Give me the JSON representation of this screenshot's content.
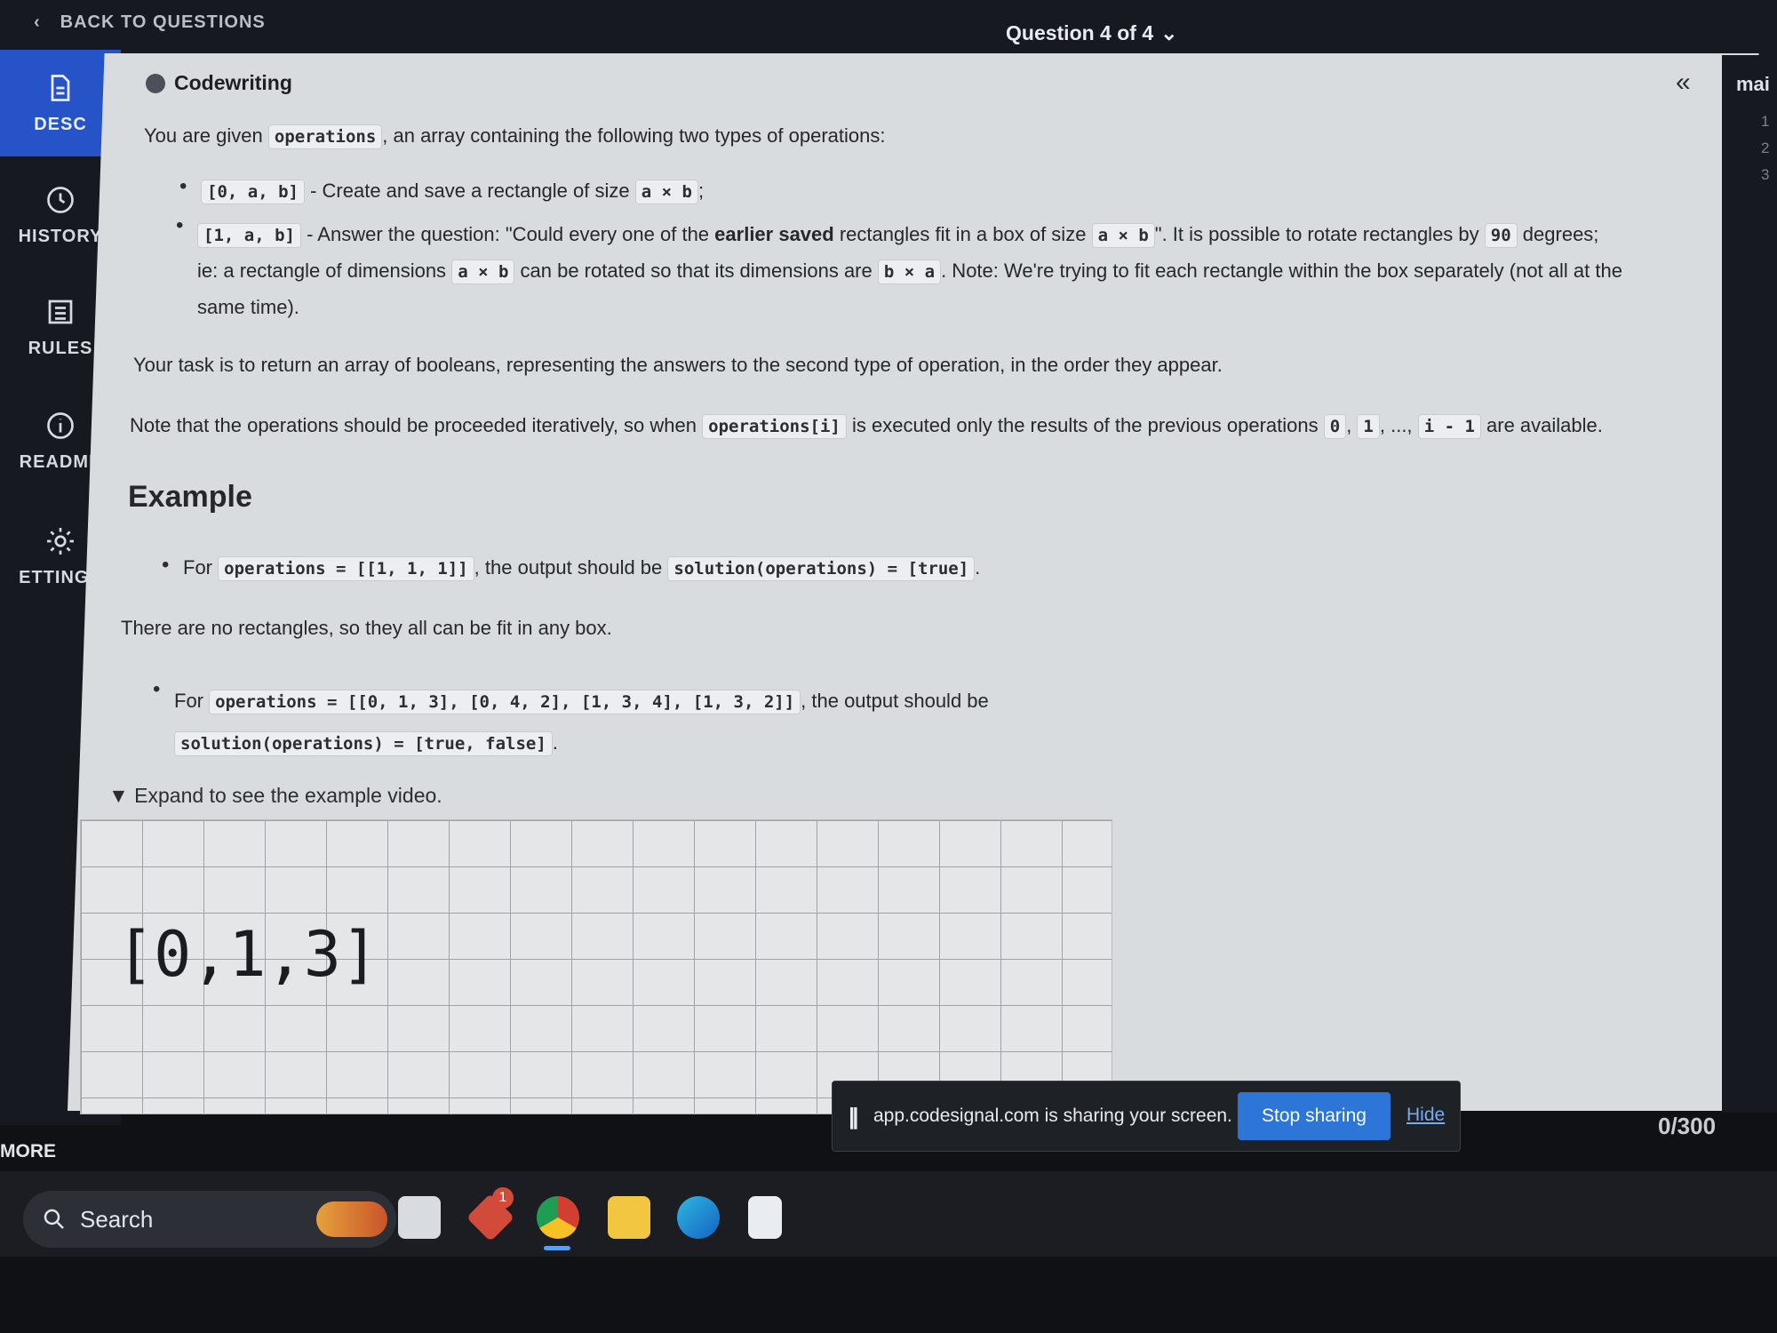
{
  "topbar": {
    "back_label": "BACK TO QUESTIONS",
    "question_selector": "Question 4 of 4"
  },
  "sidebar": {
    "items": [
      {
        "label": "DESC",
        "icon": "document-icon",
        "active": true
      },
      {
        "label": "HISTORY",
        "icon": "clock-icon",
        "active": false
      },
      {
        "label": "RULES",
        "icon": "list-icon",
        "active": false
      },
      {
        "label": "README",
        "icon": "info-icon",
        "active": false
      },
      {
        "label": "ETTINGS",
        "icon": "gear-icon",
        "active": false
      }
    ],
    "more_label": "MORE"
  },
  "description": {
    "header": "Codewriting",
    "intro_pre": "You are given",
    "intro_code": "operations",
    "intro_post": ", an array containing the following two types of operations:",
    "op1_code": "[0, a, b]",
    "op1_text": "- Create and save a rectangle of size",
    "op1_size": "a × b",
    "op1_end": ";",
    "op2_code": "[1, a, b]",
    "op2_text1": "- Answer the question: \"Could every one of the",
    "op2_bold": "earlier saved",
    "op2_text2": "rectangles fit in a box of size",
    "op2_size": "a × b",
    "op2_text3": "\". It is possible to rotate rectangles by",
    "op2_deg": "90",
    "op2_text4": "degrees;",
    "op2_line2a": "ie: a rectangle of dimensions",
    "op2_line2_code1": "a × b",
    "op2_line2b": "can be rotated so that its dimensions are",
    "op2_line2_code2": "b × a",
    "op2_line2c": ". Note: We're trying to fit each rectangle within the box separately (not all at the",
    "op2_line3": "same time).",
    "task": "Your task is to return an array of booleans, representing the answers to the second type of operation, in the order they appear.",
    "note_pre": "Note that the operations should be proceeded iteratively, so when",
    "note_code": "operations[i]",
    "note_mid": "is executed only the results of the previous operations",
    "note_c0": "0",
    "note_c1": "1",
    "note_dots": ", ...,",
    "note_ci": "i - 1",
    "note_post": "are available."
  },
  "example": {
    "heading": "Example",
    "ex1_for": "For",
    "ex1_code": "operations = [[1, 1, 1]]",
    "ex1_mid": ", the output should be",
    "ex1_out": "solution(operations) = [true]",
    "ex1_explain": "There are no rectangles, so they all can be fit in any box.",
    "ex2_for": "For",
    "ex2_code": "operations = [[0, 1, 3], [0, 4, 2], [1, 3, 4], [1, 3, 2]]",
    "ex2_mid": ", the output should be",
    "ex2_out": "solution(operations) = [true, false]",
    "expand_label": "Expand to see the example video.",
    "video_text": "[0,1,3]"
  },
  "share_bar": {
    "message": "app.codesignal.com is sharing your screen.",
    "stop_label": "Stop sharing",
    "hide_label": "Hide"
  },
  "editor": {
    "tab_label": "mai",
    "char_counter": "0/300"
  },
  "taskbar": {
    "search_label": "Search",
    "badge_count": "1"
  }
}
